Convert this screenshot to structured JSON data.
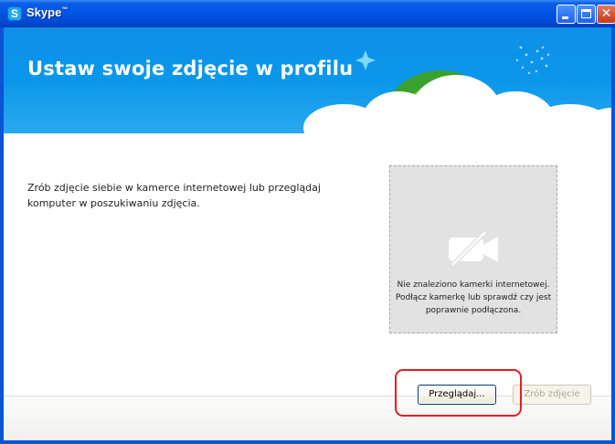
{
  "window": {
    "title": "Skype",
    "title_mark": "™",
    "app_icon_letter": "S",
    "controls": {
      "minimize_icon": "minimize-icon",
      "maximize_icon": "maximize-icon",
      "close_icon": "close-icon",
      "close_glyph": "✕"
    }
  },
  "banner": {
    "title": "Ustaw swoje zdjęcie w profilu"
  },
  "content": {
    "description": "Zrób zdjęcie siebie w kamerce internetowej lub przeglądaj komputer w poszukiwaniu zdjęcia."
  },
  "camera_preview": {
    "icon": "no-camera-icon",
    "message": "Nie znaleziono kamerki internetowej. Podłącz kamerkę lub sprawdź czy jest poprawnie podłączona."
  },
  "footer": {
    "browse_label": "Przeglądaj...",
    "snapshot_label": "Zrób zdjęcie"
  },
  "colors": {
    "banner_blue": "#0a97ea",
    "title_bar": "#0054e3",
    "highlight_red": "#e02020"
  }
}
